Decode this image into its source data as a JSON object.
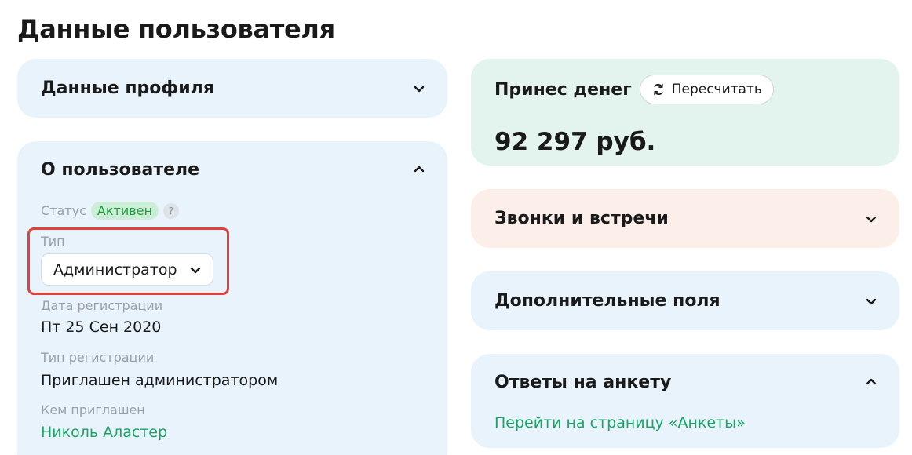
{
  "page": {
    "title": "Данные пользователя"
  },
  "profile": {
    "title": "Данные профиля"
  },
  "about": {
    "title": "О пользователе",
    "status_label": "Статус",
    "status_value": "Активен",
    "status_help": "?",
    "type_label": "Тип",
    "type_value": "Администратор",
    "reg_date_label": "Дата регистрации",
    "reg_date_value": "Пт 25 Сен 2020",
    "reg_type_label": "Тип регистрации",
    "reg_type_value": "Приглашен администратором",
    "invited_by_label": "Кем приглашен",
    "invited_by_value": "Николь Аластер"
  },
  "money": {
    "title": "Принес денег",
    "recalc_label": "Пересчитать",
    "amount": "92 297 руб."
  },
  "calls": {
    "title": "Звонки и встречи"
  },
  "extra": {
    "title": "Дополнительные поля"
  },
  "survey": {
    "title": "Ответы на анкету",
    "link": "Перейти на страницу «Анкеты»"
  },
  "colors": {
    "accent_green": "#1aa564",
    "highlight_red": "#e0413a",
    "card_blue": "#e8f3fb",
    "card_green": "#e3f4ee",
    "card_peach": "#fcefea"
  },
  "icons": {
    "chevron_down": "chevron-down-icon",
    "chevron_up": "chevron-up-icon",
    "refresh": "refresh-icon"
  }
}
